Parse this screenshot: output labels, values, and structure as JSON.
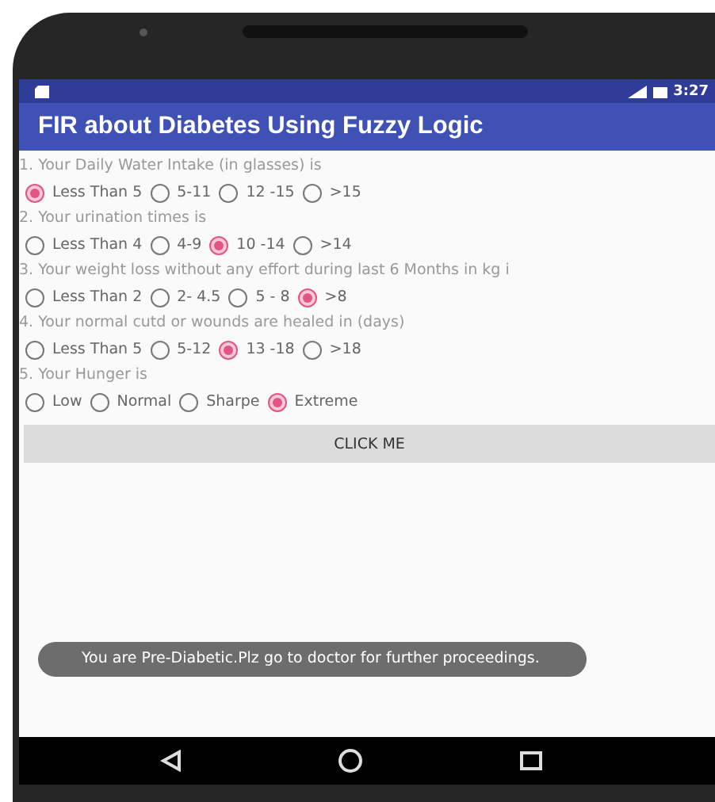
{
  "status_bar": {
    "time": "3:27"
  },
  "app_bar": {
    "title": "FIR about Diabetes Using Fuzzy Logic"
  },
  "questions": [
    {
      "label": "1. Your Daily Water Intake (in glasses) is",
      "options": [
        {
          "label": "Less Than 5",
          "selected": true
        },
        {
          "label": "5-11",
          "selected": false
        },
        {
          "label": "12 -15",
          "selected": false
        },
        {
          "label": ">15",
          "selected": false
        }
      ]
    },
    {
      "label": "2. Your urination times is",
      "options": [
        {
          "label": "Less Than 4",
          "selected": false
        },
        {
          "label": "4-9",
          "selected": false
        },
        {
          "label": "10 -14",
          "selected": true
        },
        {
          "label": ">14",
          "selected": false
        }
      ]
    },
    {
      "label": "3. Your weight loss without any effort during last 6 Months in kg i",
      "options": [
        {
          "label": "Less Than 2",
          "selected": false
        },
        {
          "label": "2- 4.5",
          "selected": false
        },
        {
          "label": "5 - 8",
          "selected": false
        },
        {
          "label": ">8",
          "selected": true
        }
      ]
    },
    {
      "label": "4. Your normal cutd or wounds are healed in (days)",
      "options": [
        {
          "label": "Less Than 5",
          "selected": false
        },
        {
          "label": "5-12",
          "selected": false
        },
        {
          "label": "13 -18",
          "selected": true
        },
        {
          "label": ">18",
          "selected": false
        }
      ]
    },
    {
      "label": "5. Your Hunger is",
      "options": [
        {
          "label": "Low",
          "selected": false
        },
        {
          "label": "Normal",
          "selected": false
        },
        {
          "label": "Sharpe",
          "selected": false
        },
        {
          "label": "Extreme",
          "selected": true
        }
      ]
    }
  ],
  "button": {
    "label": "CLICK ME"
  },
  "toast": {
    "text": "You are Pre-Diabetic.Plz go to doctor for further proceedings."
  }
}
